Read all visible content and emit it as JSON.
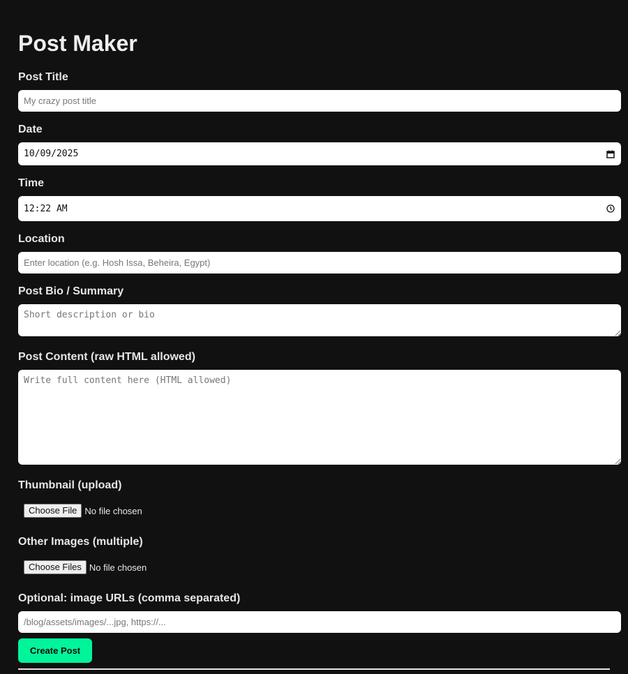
{
  "page": {
    "title": "Post Maker"
  },
  "form": {
    "post_title": {
      "label": "Post Title",
      "placeholder": "My crazy post title",
      "value": ""
    },
    "date": {
      "label": "Date",
      "value": "10/09/2025"
    },
    "time": {
      "label": "Time",
      "value": "12:22 AM"
    },
    "location": {
      "label": "Location",
      "placeholder": "Enter location (e.g. Hosh Issa, Beheira, Egypt)",
      "value": ""
    },
    "bio": {
      "label": "Post Bio / Summary",
      "placeholder": "Short description or bio"
    },
    "content": {
      "label": "Post Content (raw HTML allowed)",
      "placeholder": "Write full content here (HTML allowed)"
    },
    "thumbnail": {
      "label": "Thumbnail (upload)",
      "button": "Choose File",
      "status": "No file chosen"
    },
    "other_images": {
      "label": "Other Images (multiple)",
      "button": "Choose Files",
      "status": "No file chosen"
    },
    "image_urls": {
      "label": "Optional: image URLs (comma separated)",
      "placeholder": "/blog/assets/images/...jpg, https://..."
    },
    "submit_label": "Create Post"
  },
  "icons": {
    "date_picker": "calendar-icon",
    "time_picker": "clock-icon"
  },
  "colors": {
    "background": "#111111",
    "accent": "#00f59a",
    "text": "#e6e6e6"
  }
}
